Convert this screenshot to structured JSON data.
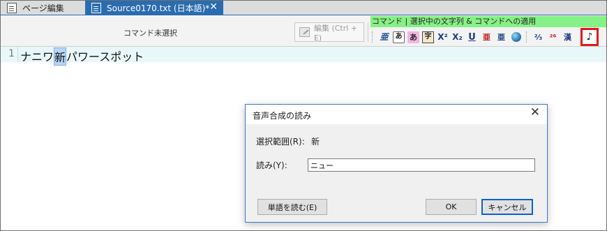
{
  "tabs": [
    {
      "label": "ページ編集",
      "active": false
    },
    {
      "label": "Source0170.txt (日本語)*",
      "active": true
    }
  ],
  "tab_close": "✕",
  "toolbar": {
    "command_status": "コマンド未選択",
    "edit_button": "編集 (Ctrl + E)",
    "command_header": "コマンド | 選択中の文字列 & コマンドへの適用",
    "icons": [
      {
        "name": "ruby-icon",
        "glyph": "亜"
      },
      {
        "name": "hiragana-icon",
        "glyph": "あ"
      },
      {
        "name": "hiragana-highlight-icon",
        "glyph": "あ"
      },
      {
        "name": "kanji-icon",
        "glyph": "字"
      },
      {
        "name": "superscript-icon",
        "glyph": "X²"
      },
      {
        "name": "subscript-icon",
        "glyph": "X₂"
      },
      {
        "name": "underline-icon",
        "glyph": "U"
      },
      {
        "name": "emphasis-dot-icon",
        "glyph": "亜"
      },
      {
        "name": "emphasis-dot-alt-icon",
        "glyph": "亜"
      },
      {
        "name": "globe-icon",
        "glyph": ""
      },
      {
        "name": "tatechuyoko-icon",
        "glyph": "²⁄₃"
      },
      {
        "name": "number-rotate-icon",
        "glyph": "²⁶"
      },
      {
        "name": "kanji-bracket-icon",
        "glyph": "漢"
      }
    ],
    "speech_icon_glyph": "♪",
    "highlight_color": "#e01b1b",
    "command_header_color": "#86f186"
  },
  "editor": {
    "line_number": "1",
    "text_before": "ナニワ",
    "text_selected": "新",
    "text_after": "パワースポット"
  },
  "dialog": {
    "title": "音声合成の読み",
    "close": "✕",
    "range_label": "選択範囲(R):",
    "range_value": "新",
    "reading_label": "読み(Y):",
    "reading_value": "ニュー",
    "word_button": "単語を読む(E)",
    "ok_button": "OK",
    "cancel_button": "キャンセル"
  }
}
